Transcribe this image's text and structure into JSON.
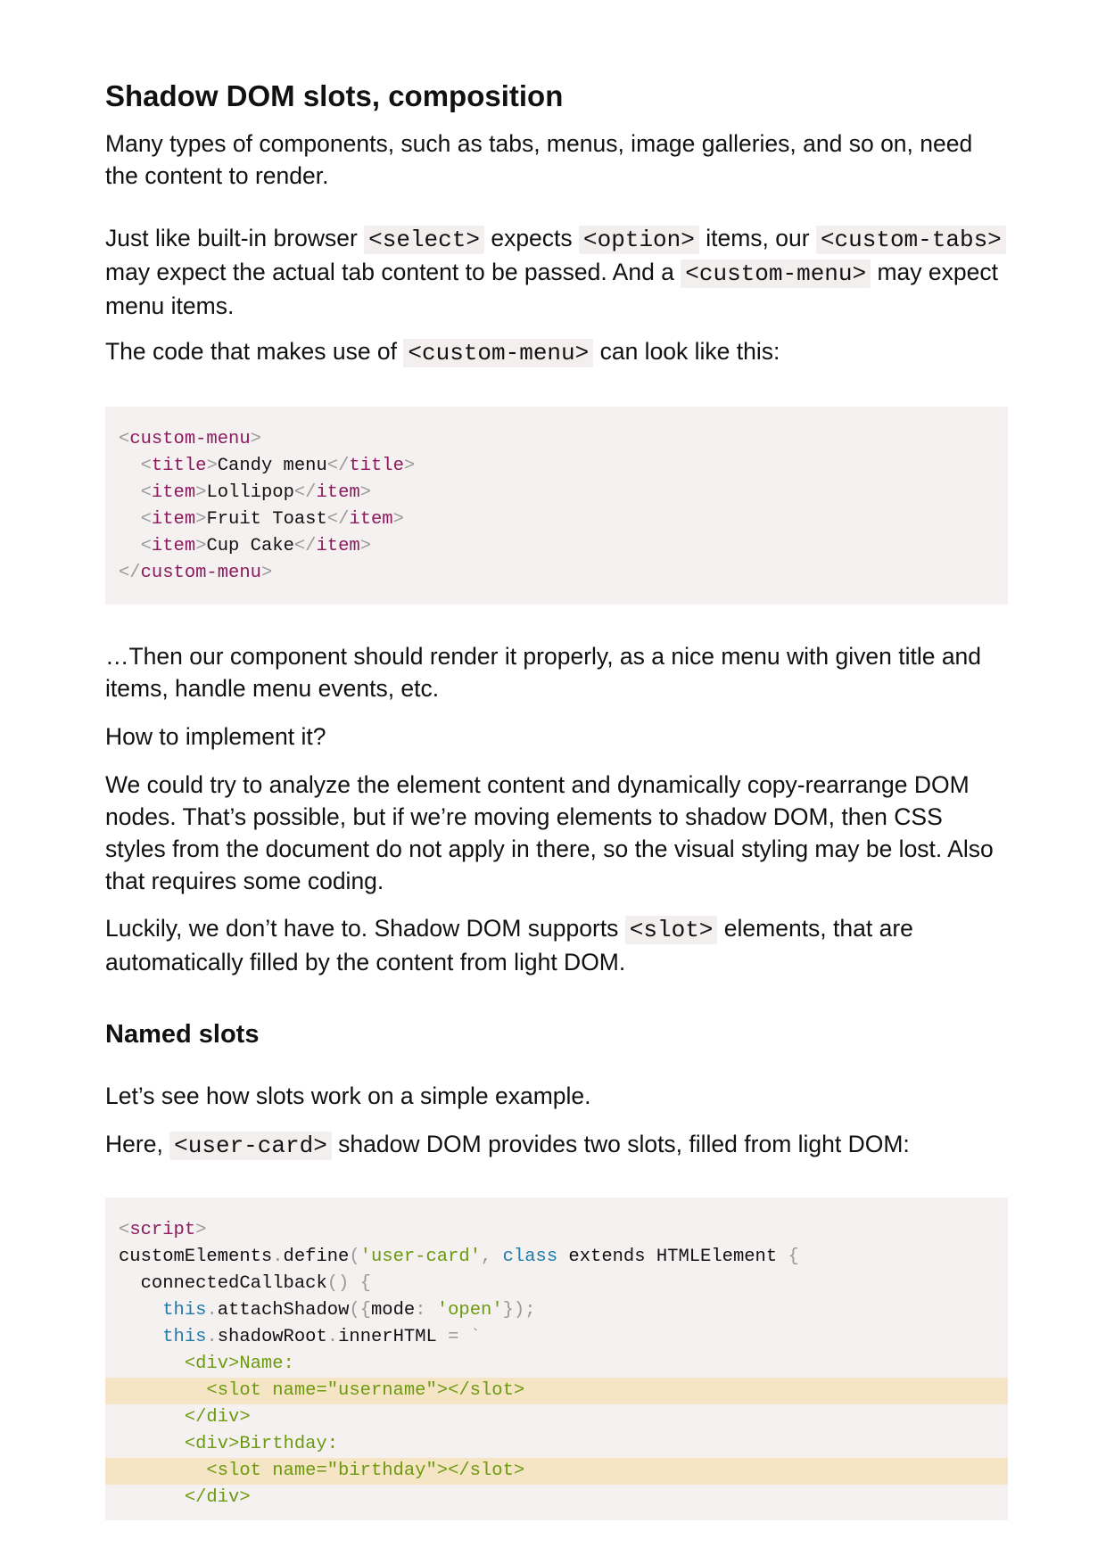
{
  "heading1": "Shadow DOM slots, composition",
  "p1": "Many types of components, such as tabs, menus, image galleries, and so on, need the content to render.",
  "p2": {
    "t1": "Just like built-in browser ",
    "c1": "<select>",
    "t2": " expects ",
    "c2": "<option>",
    "t3": " items, our ",
    "c3": "<custom-tabs>",
    "t4": " may expect the actual tab content to be passed. And a ",
    "c4": "<custom-menu>",
    "t5": " may expect menu items."
  },
  "p3": {
    "t1": "The code that makes use of ",
    "c1": "<custom-menu>",
    "t2": " can look like this:"
  },
  "code1": {
    "open_tag": "custom-menu",
    "title_tag": "title",
    "title_text": "Candy menu",
    "item_tag": "item",
    "items": [
      "Lollipop",
      "Fruit Toast",
      "Cup Cake"
    ]
  },
  "p4": "…Then our component should render it properly, as a nice menu with given title and items, handle menu events, etc.",
  "p5": "How to implement it?",
  "p6": "We could try to analyze the element content and dynamically copy-rearrange DOM nodes. That’s possible, but if we’re moving elements to shadow DOM, then CSS styles from the document do not apply in there, so the visual styling may be lost. Also that requires some coding.",
  "p7": {
    "t1": "Luckily, we don’t have to. Shadow DOM supports ",
    "c1": "<slot>",
    "t2": " elements, that are automatically filled by the content from light DOM."
  },
  "heading2": "Named slots",
  "p8": "Let’s see how slots work on a simple example.",
  "p9": {
    "t1": "Here, ",
    "c1": "<user-card>",
    "t2": " shadow DOM provides two slots, filled from light DOM:"
  },
  "code2": {
    "script_tag": "script",
    "obj": "customElements",
    "method": "define",
    "name_str": "'user-card'",
    "kw_class": "class",
    "extends_text": " extends HTMLElement ",
    "connected": "connectedCallback",
    "kw_this": "this",
    "attach": "attachShadow",
    "mode_key": "mode",
    "mode_val": "'open'",
    "shadow_root": "shadowRoot",
    "inner_html": "innerHTML",
    "t_div_name": "<div>Name:",
    "t_slot_username": "<slot name=\"username\"></slot>",
    "t_div_close1": "</div>",
    "t_div_birthday": "<div>Birthday:",
    "t_slot_birthday": "<slot name=\"birthday\"></slot>",
    "t_div_close2": "</div>"
  }
}
